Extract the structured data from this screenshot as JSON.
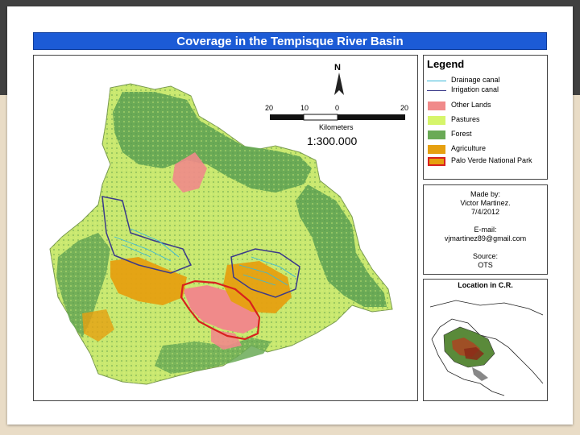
{
  "map_title": "Coverage in the Tempisque River Basin",
  "north_label": "N",
  "scale": {
    "ticks": [
      "20",
      "10",
      "0",
      "20"
    ],
    "unit": "Kilometers",
    "ratio": "1:300.000"
  },
  "legend": {
    "title": "Legend",
    "line_items": [
      {
        "label": "Drainage canal",
        "color": "#39b8d8"
      },
      {
        "label": "Irrigation canal",
        "color": "#3a3a8a"
      }
    ],
    "fill_items": [
      {
        "label": "Other Lands",
        "color": "#f08a8a"
      },
      {
        "label": "Pastures",
        "color": "#d6f56b"
      },
      {
        "label": "Forest",
        "color": "#6aaa56"
      },
      {
        "label": "Agriculture",
        "color": "#e6a010"
      },
      {
        "label": "Palo Verde National Park",
        "color": "#e6a010",
        "outline": "#d8201e"
      }
    ]
  },
  "credits": {
    "made_by_label": "Made by:",
    "author": "Victor Martinez.",
    "date": "7/4/2012",
    "email_label": "E-mail:",
    "email": "vjmartinez89@gmail.com",
    "source_label": "Source:",
    "source": "OTS"
  },
  "location_title": "Location in C.R.",
  "colors": {
    "title_bar": "#1c5bd6",
    "forest": "#6aaa56",
    "pastures": "#c9e870",
    "agriculture": "#e6a010",
    "other_lands": "#f08a8a",
    "park_outline": "#d8201e"
  }
}
